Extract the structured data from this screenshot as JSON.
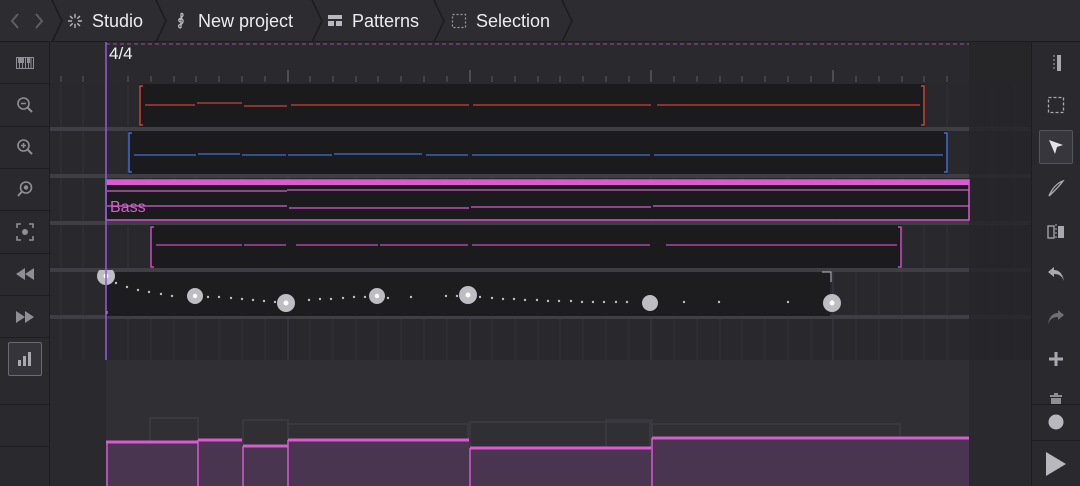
{
  "breadcrumbs": {
    "studio": "Studio",
    "project": "New project",
    "patterns": "Patterns",
    "selection": "Selection"
  },
  "timeline": {
    "time_signature": "4/4"
  },
  "tracks": {
    "bass_label": "Bass"
  },
  "colors": {
    "accent": "#d85bd0",
    "red_clip": "#c9443e",
    "blue_clip": "#3f6fd6",
    "playhead": "#8a5bd6",
    "automation_dot": "#bdbdc2"
  },
  "icons": {
    "left_toolbar": [
      "piano-keys-icon",
      "zoom-out-icon",
      "zoom-in-icon",
      "zoom-search-icon",
      "zoom-fit-icon",
      "rewind-icon",
      "fast-forward-icon",
      "bar-chart-icon"
    ],
    "right_toolbar": [
      "split-icon",
      "marquee-select-icon",
      "pointer-icon",
      "pen-icon",
      "mirror-icon",
      "undo-icon",
      "redo-icon",
      "plus-icon",
      "delete-icon",
      "record-icon",
      "play-icon"
    ]
  }
}
